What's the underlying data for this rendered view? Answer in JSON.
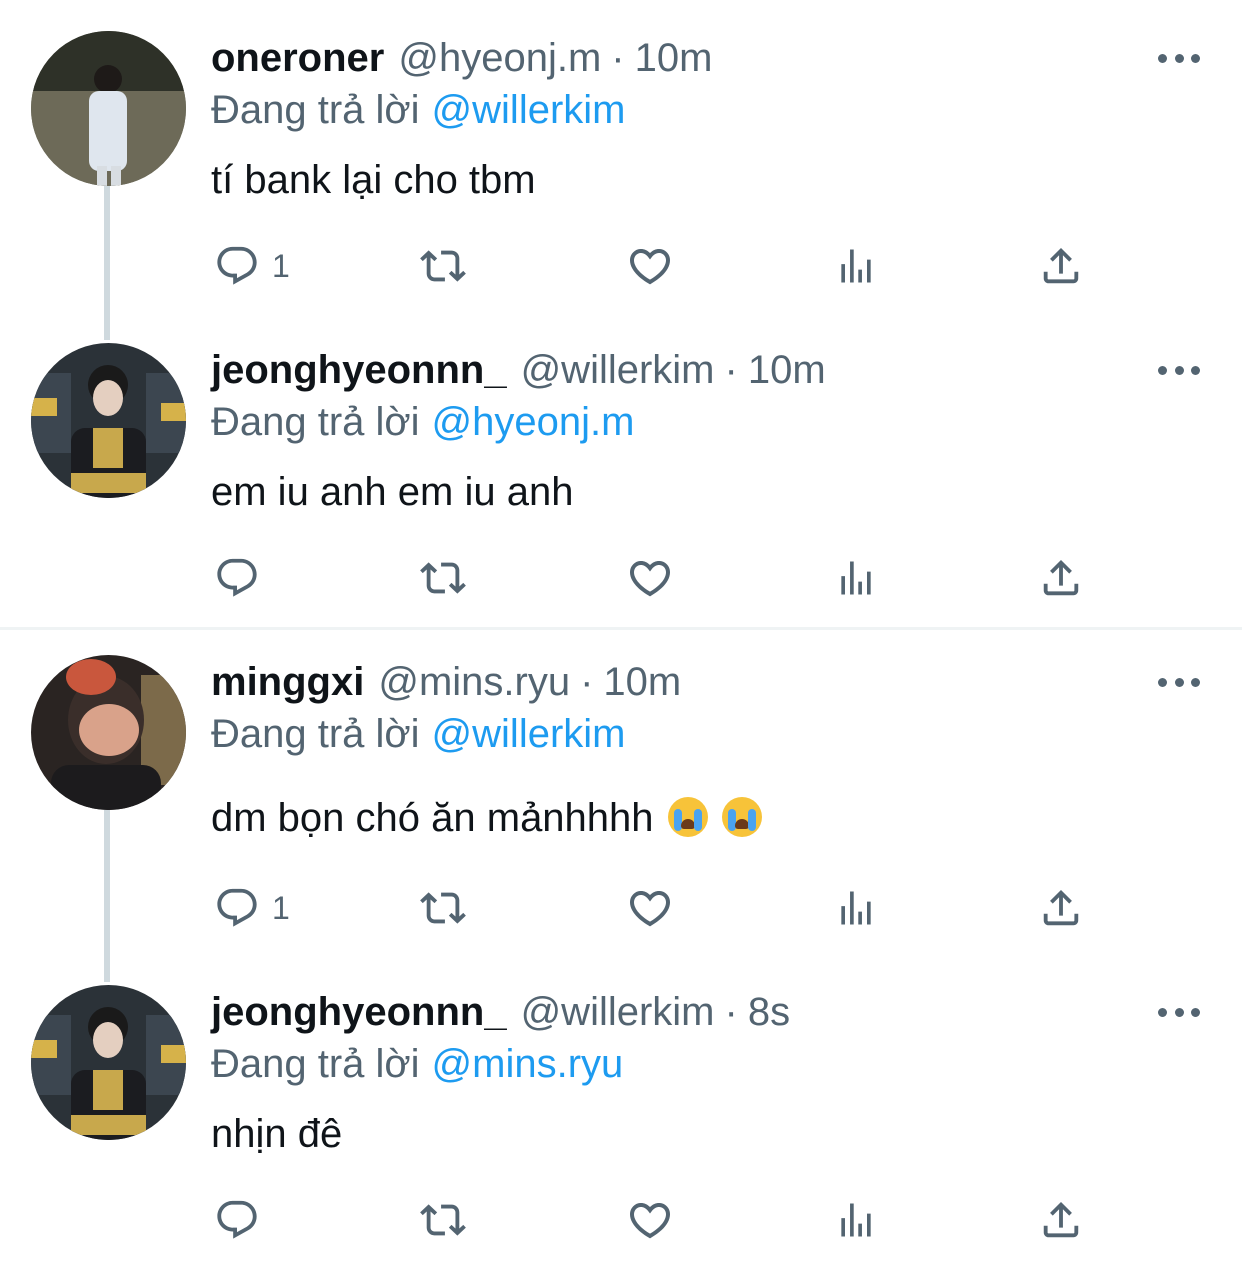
{
  "reply_prefix": "Đang trả lời",
  "tweets": [
    {
      "name": "oneroner",
      "handle": "@hyeonj.m",
      "time": "10m",
      "replying_to": "@willerkim",
      "text": "tí bank lại cho tbm",
      "reply_count": "1"
    },
    {
      "name": "jeonghyeonnn_",
      "handle": "@willerkim",
      "time": "10m",
      "replying_to": "@hyeonj.m",
      "text": "em iu anh em iu anh",
      "reply_count": ""
    },
    {
      "name": "minggxi",
      "handle": "@mins.ryu",
      "time": "10m",
      "replying_to": "@willerkim",
      "text": "dm bọn chó ăn mảnhhhh",
      "reply_count": "1",
      "emoji": [
        "loudly-crying-face",
        "loudly-crying-face"
      ]
    },
    {
      "name": "jeonghyeonnn_",
      "handle": "@willerkim",
      "time": "8s",
      "replying_to": "@mins.ryu",
      "text": "nhịn đê",
      "reply_count": ""
    }
  ],
  "colors": {
    "text": "#0f1419",
    "secondary": "#536471",
    "link": "#1d9bf0",
    "thread_line": "#cfd9de",
    "divider": "#eff3f4"
  },
  "icons": [
    "reply-icon",
    "retweet-icon",
    "like-icon",
    "analytics-icon",
    "share-icon",
    "more-icon"
  ]
}
